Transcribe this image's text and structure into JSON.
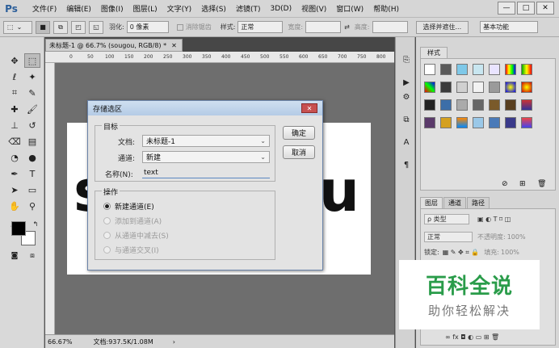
{
  "menubar": {
    "logo": "Ps",
    "items": [
      "文件(F)",
      "编辑(E)",
      "图像(I)",
      "图层(L)",
      "文字(Y)",
      "选择(S)",
      "滤镜(T)",
      "3D(D)",
      "视图(V)",
      "窗口(W)",
      "帮助(H)"
    ],
    "window_buttons": [
      "—",
      "□",
      "✕"
    ]
  },
  "optbar": {
    "feather_label": "羽化:",
    "feather_value": "0 像素",
    "antialias_label": "消除锯齿",
    "style_label": "样式:",
    "style_value": "正常",
    "width_label": "宽度:",
    "height_label": "高度:",
    "select_mask_button": "选择并遮住...",
    "workspace_value": "基本功能"
  },
  "document": {
    "tab_title": "未标题-1 @ 66.7% (sougou, RGB/8) *",
    "ruler_marks": [
      "0",
      "50",
      "100",
      "150",
      "200",
      "250",
      "300",
      "350",
      "400",
      "450",
      "500",
      "550",
      "600",
      "650",
      "700",
      "750",
      "800"
    ],
    "canvas_text": [
      "s",
      "u"
    ],
    "zoom": "66.67%",
    "doc_info": "文档:937.5K/1.08M"
  },
  "dialog": {
    "title": "存储选区",
    "target_group": "目标",
    "doc_label": "文档:",
    "doc_value": "未标题-1",
    "channel_label": "通道:",
    "channel_value": "新建",
    "name_label": "名称(N):",
    "name_value": "text",
    "ops_group": "操作",
    "ops": [
      {
        "label": "新建通道(E)",
        "selected": true,
        "enabled": true
      },
      {
        "label": "添加到通道(A)",
        "selected": false,
        "enabled": false
      },
      {
        "label": "从通道中减去(S)",
        "selected": false,
        "enabled": false
      },
      {
        "label": "与通道交叉(I)",
        "selected": false,
        "enabled": false
      }
    ],
    "ok_label": "确定",
    "cancel_label": "取消"
  },
  "panels": {
    "styles_tab": "样式",
    "layer_tabs": [
      "图层",
      "通道",
      "路径"
    ],
    "kind_label": "ρ 类型",
    "blend_mode": "正常",
    "opacity_label": "不透明度:",
    "opacity_value": "100%",
    "lock_label": "锁定:",
    "fill_label": "填充:",
    "fill_value": "100%"
  },
  "watermark": {
    "main": "百科全说",
    "sub": "助你轻松解决"
  },
  "colors": {
    "accent": "#2a9c4a",
    "foreground": "#000000",
    "background": "#ffffff"
  }
}
